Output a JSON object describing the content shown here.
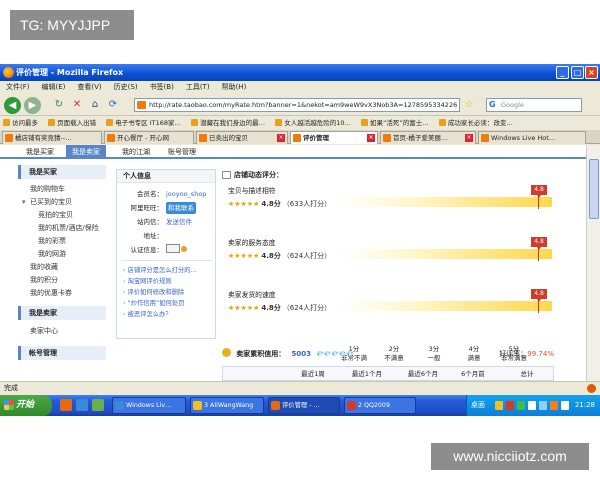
{
  "watermarks": {
    "top": "TG: MYYJJPP",
    "bottom": "www.nicciiotz.com"
  },
  "window": {
    "title": "评价管理 - Mozilla Firefox"
  },
  "menu": [
    "文件(F)",
    "编辑(E)",
    "查看(V)",
    "历史(S)",
    "书签(B)",
    "工具(T)",
    "帮助(H)"
  ],
  "address": {
    "url": "http://rate.taobao.com/myRate.htm?banner=1&nekot=am9weW9vX3Nob3A=1278595334226",
    "search_placeholder": "Google"
  },
  "bookmarks": [
    "访问最多",
    "页面载入出错",
    "电子书专区 IT168家…",
    "潜藏在我们身边的最…",
    "女人越活越危险的10…",
    "如果“活死”的富士…",
    "成功家长必读：改变…"
  ],
  "tabs": [
    {
      "label": "橘店铺有奖竞猜--…"
    },
    {
      "label": "开心餐厅 - 开心网"
    },
    {
      "label": "已卖出的宝贝"
    },
    {
      "label": "评价管理"
    },
    {
      "label": "首页-橘子爱美丽…"
    },
    {
      "label": "Windows Live Hot…"
    }
  ],
  "subnav": [
    "我是买家",
    "我是卖家",
    "我的江湖",
    "账号管理"
  ],
  "sidebar": {
    "buyer_heading": "我是买家",
    "buyer_items": [
      "我的购物车",
      "已买到的宝贝",
      "竞拍的宝贝",
      "我的机票/酒店/保险",
      "我的彩票",
      "我的网游",
      "我的收藏",
      "我的积分",
      "我的优惠卡券"
    ],
    "seller_heading": "我是卖家",
    "seller_items": [
      "卖家中心"
    ],
    "more_heading": "帐号管理"
  },
  "personal_info": {
    "heading": "个人信息",
    "member_label": "会员名：",
    "member_value": "jooyoo_shop",
    "wangwang_label": "阿里旺旺：",
    "wangwang_value": "和我联系",
    "message_label": "站内信：",
    "message_value": "发送信件",
    "address_label": "地址：",
    "address_value": "",
    "verify_label": "认证信息："
  },
  "faq_links": [
    "店铺评分是怎么打分的…",
    "淘宝网评价规则",
    "评价如何修改和删除",
    "“炒作信用”如何处罚",
    "被恶评怎么办？"
  ],
  "ratings": {
    "heading": "店铺动态评分：",
    "scale": [
      {
        "score": "1分",
        "desc": "非常不满"
      },
      {
        "score": "2分",
        "desc": "不满意"
      },
      {
        "score": "3分",
        "desc": "一般"
      },
      {
        "score": "4分",
        "desc": "满意"
      },
      {
        "score": "5分",
        "desc": "非常满意"
      }
    ],
    "dimensions": [
      {
        "label": "宝贝与描述相符",
        "stars": "★★★★★",
        "score": "4.8分",
        "count": "（633人打分）",
        "flag": "4.8",
        "value": 4.8
      },
      {
        "label": "卖家的服务态度",
        "stars": "★★★★★",
        "score": "4.8分",
        "count": "（624人打分）",
        "flag": "4.8",
        "value": 4.8
      },
      {
        "label": "卖家发货的速度",
        "stars": "★★★★★",
        "score": "4.8分",
        "count": "（624人打分）",
        "flag": "4.8",
        "value": 4.8
      }
    ]
  },
  "seller_credit": {
    "label": "卖家累积信用：",
    "value": "5003",
    "diamonds": "💎💎💎💎💎",
    "positive_label": "好评率：",
    "positive_value": "99.74%"
  },
  "credit_table": {
    "headers": [
      "最近1周",
      "最近1个月",
      "最近6个月",
      "6个月前",
      "总计"
    ]
  },
  "statusbar": {
    "text": "完成"
  },
  "taskbar": {
    "start": "开始",
    "tasks": [
      "Windows Liv…",
      "3 AliWangWang",
      "评价管理 - …",
      "2 QQ2009"
    ],
    "tray_text": "桌面",
    "clock": "21:28"
  },
  "colors": {
    "accent": "#5a86c8",
    "titlebar": "#0a4fd4",
    "flag": "#d23a2a",
    "star": "#f0a000",
    "link": "#3366cc"
  }
}
